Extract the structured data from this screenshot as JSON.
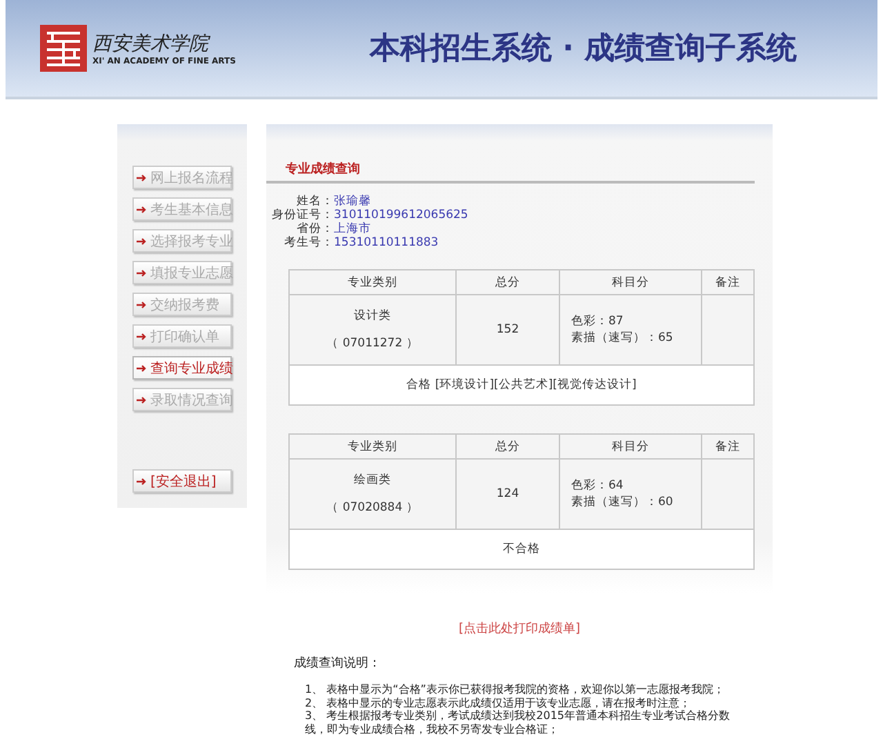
{
  "header": {
    "logo_cn": "西安美术学院",
    "logo_en": "XI' AN ACADEMY OF FINE ARTS",
    "title": "本科招生系统 · 成绩查询子系统"
  },
  "sidebar": {
    "items": [
      {
        "label": "网上报名流程",
        "selected": false
      },
      {
        "label": "考生基本信息",
        "selected": false
      },
      {
        "label": "选择报考专业",
        "selected": false
      },
      {
        "label": "填报专业志愿",
        "selected": false
      },
      {
        "label": "交纳报考费",
        "selected": false
      },
      {
        "label": "打印确认单",
        "selected": false
      },
      {
        "label": "查询专业成绩",
        "selected": true
      },
      {
        "label": "录取情况查询",
        "selected": false
      }
    ],
    "logout": "[安全退出]"
  },
  "main": {
    "section_title": "专业成绩查询",
    "info": [
      {
        "label": "姓名：",
        "value": "张瑜馨"
      },
      {
        "label": "身份证号：",
        "value": "310110199612065625"
      },
      {
        "label": "省份：",
        "value": "上海市"
      },
      {
        "label": "考生号：",
        "value": "15310110111883"
      }
    ],
    "results": [
      {
        "columns": [
          "专业类别",
          "总分",
          "科目分",
          "备注"
        ],
        "category": "设计类",
        "code": "（ 07011272 ）",
        "total": "152",
        "scores": [
          "色彩：87",
          "素描（速写）：65"
        ],
        "result": "合格 [环境设计][公共艺术][视觉传达设计]"
      },
      {
        "columns": [
          "专业类别",
          "总分",
          "科目分",
          "备注"
        ],
        "category": "绘画类",
        "code": "（ 07020884 ）",
        "total": "124",
        "scores": [
          "色彩：64",
          "素描（速写）：60"
        ],
        "result": "不合格"
      }
    ],
    "print_link": "[点击此处打印成绩单]",
    "notes_title": "成绩查询说明：",
    "notes": [
      "1、 表格中显示为“合格”表示你已获得报考我院的资格，欢迎你以第一志愿报考我院；",
      "2、 表格中显示的专业志愿表示此成绩仅适用于该专业志愿，请在报考时注意；",
      "3、 考生根据报考专业类别，考试成绩达到我校2015年普通本科招生专业考试合格分数线，即为专业成绩合格，我校不另寄发专业合格证；"
    ]
  }
}
